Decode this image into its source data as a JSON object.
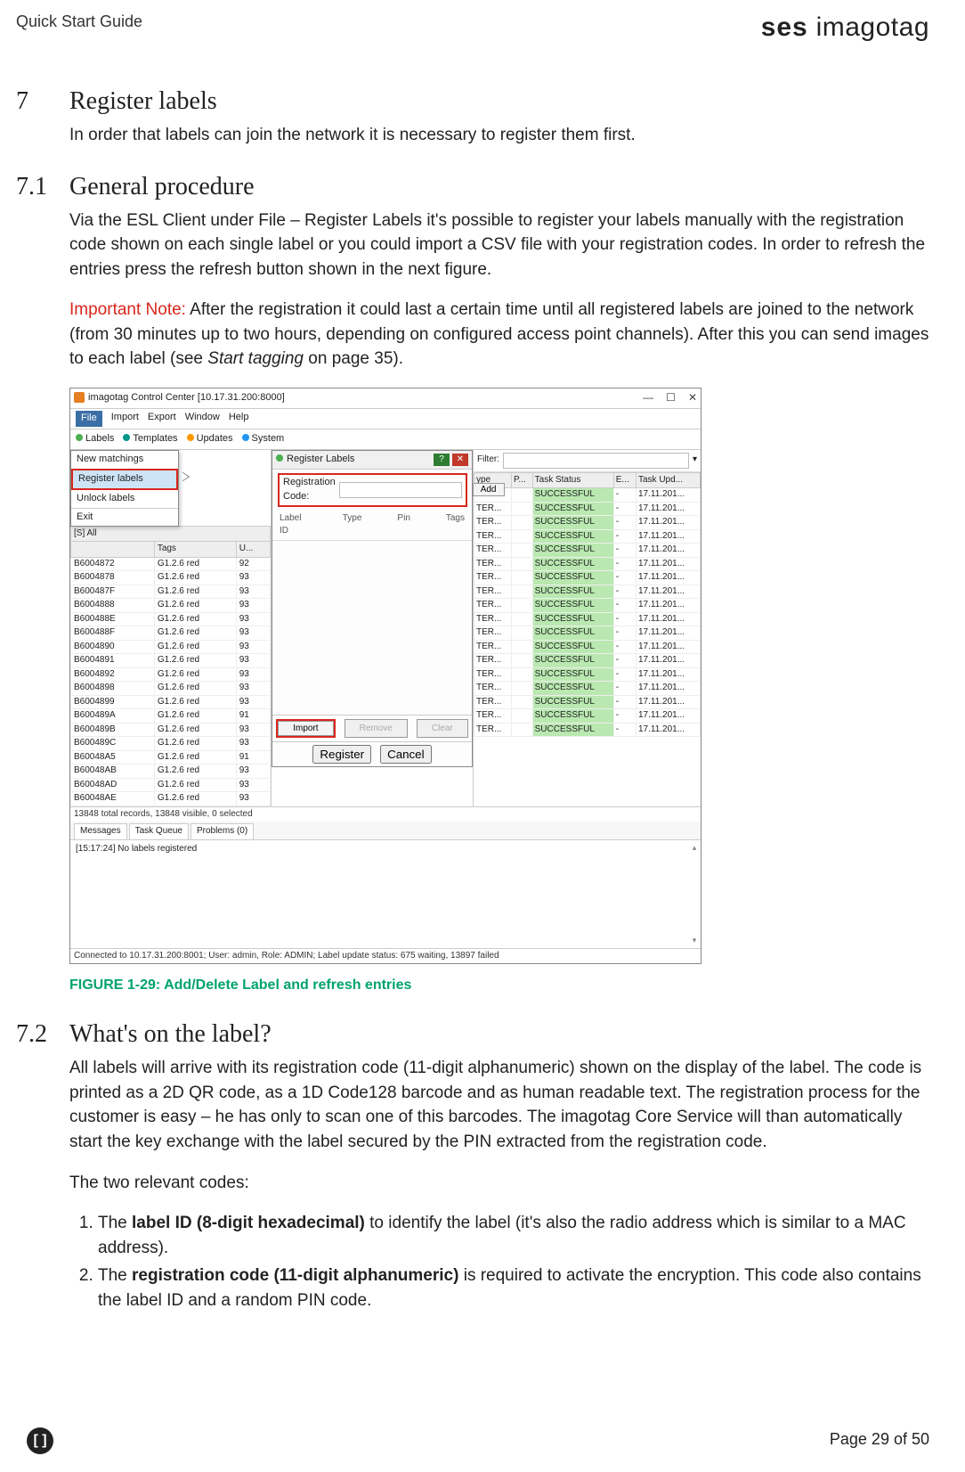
{
  "header": {
    "left": "Quick Start Guide",
    "brand_bold": "ses",
    "brand_light": " imagotag"
  },
  "s7": {
    "num": "7",
    "title": "Register labels",
    "intro": "In order that labels can join the network it is necessary to register them first."
  },
  "s71": {
    "num": "7.1",
    "title": "General procedure",
    "p1": "Via the ESL Client under File – Register Labels it's possible to register your labels manually with the registration code shown on each single label or you could import a CSV file with your registration codes. In order to refresh the entries press the refresh button shown in the next figure.",
    "note_label": "Important Note:",
    "note_rest": " After the registration it could last a certain time until all registered labels are joined to the network (from 30 minutes up to two hours, depending on configured access point channels). After this you can send images to each label (see ",
    "note_italic": "Start tagging",
    "note_tail": " on page 35).",
    "fig_caption": "FIGURE 1-29: Add/Delete Label and refresh entries"
  },
  "s72": {
    "num": "7.2",
    "title": "What's on the label?",
    "p1": "All labels will arrive with its registration code (11-digit alphanumeric) shown on the display of the label. The code is printed as a 2D QR code, as a 1D Code128 barcode and as human readable text. The registration process for the customer is easy – he has only to scan one of this barcodes. The imagotag Core Service will than automatically start the key exchange with the label secured by the PIN extracted from the registration code.",
    "p2": "The two relevant codes:",
    "li1a": "The ",
    "li1b": "label ID (8-digit hexadecimal)",
    "li1c": " to identify the label (it's also the radio address which is similar to a MAC address).",
    "li2a": "The ",
    "li2b": "registration code (11-digit alphanumeric)",
    "li2c": " is required to activate the encryption. This code also contains the label ID and a random PIN code."
  },
  "shot": {
    "title": "imagotag Control Center [10.17.31.200:8000]",
    "wincontrols": {
      "min": "—",
      "max": "☐",
      "close": "✕"
    },
    "menus": [
      "File",
      "Import",
      "Export",
      "Window",
      "Help"
    ],
    "file_menu": [
      "New matchings",
      "Register labels",
      "Unlock labels",
      "Exit"
    ],
    "toolbar": [
      "Labels",
      "Templates",
      "Updates",
      "System"
    ],
    "left_search": "[S]  All",
    "left_headers": [
      "",
      "Tags",
      "U..."
    ],
    "left_rows": [
      [
        "B6004872",
        "G1.2.6 red",
        "92"
      ],
      [
        "B6004878",
        "G1.2.6 red",
        "93"
      ],
      [
        "B600487F",
        "G1.2.6 red",
        "93"
      ],
      [
        "B6004888",
        "G1.2.6 red",
        "93"
      ],
      [
        "B600488E",
        "G1.2.6 red",
        "93"
      ],
      [
        "B600488F",
        "G1.2.6 red",
        "93"
      ],
      [
        "B6004890",
        "G1.2.6 red",
        "93"
      ],
      [
        "B6004891",
        "G1.2.6 red",
        "93"
      ],
      [
        "B6004892",
        "G1.2.6 red",
        "93"
      ],
      [
        "B6004898",
        "G1.2.6 red",
        "93"
      ],
      [
        "B6004899",
        "G1.2.6 red",
        "93"
      ],
      [
        "B600489A",
        "G1.2.6 red",
        "91"
      ],
      [
        "B600489B",
        "G1.2.6 red",
        "93"
      ],
      [
        "B600489C",
        "G1.2.6 red",
        "93"
      ],
      [
        "B60048A5",
        "G1.2.6 red",
        "91"
      ],
      [
        "B60048AB",
        "G1.2.6 red",
        "93"
      ],
      [
        "B60048AD",
        "G1.2.6 red",
        "93"
      ],
      [
        "B60048AE",
        "G1.2.6 red",
        "93"
      ]
    ],
    "left_status": "13848 total records, 13848 visible, 0 selected",
    "dialog": {
      "title": "Register Labels",
      "reg_label": "Registration Code:",
      "add": "Add",
      "cols": [
        "Label ID",
        "Type",
        "Pin",
        "Tags"
      ],
      "import": "Import",
      "remove": "Remove",
      "clear": "Clear",
      "register": "Register",
      "cancel": "Cancel"
    },
    "right": {
      "filter_label": "Filter:",
      "headers": [
        "ype",
        "P...",
        "Task Status",
        "E...",
        "Task Upd..."
      ],
      "rows": [
        [
          "TER...",
          "",
          "SUCCESSFUL",
          "-",
          "17.11.201..."
        ],
        [
          "TER...",
          "",
          "SUCCESSFUL",
          "-",
          "17.11.201..."
        ],
        [
          "TER...",
          "",
          "SUCCESSFUL",
          "-",
          "17.11.201..."
        ],
        [
          "TER...",
          "",
          "SUCCESSFUL",
          "-",
          "17.11.201..."
        ],
        [
          "TER...",
          "",
          "SUCCESSFUL",
          "-",
          "17.11.201..."
        ],
        [
          "TER...",
          "",
          "SUCCESSFUL",
          "-",
          "17.11.201..."
        ],
        [
          "TER...",
          "",
          "SUCCESSFUL",
          "-",
          "17.11.201..."
        ],
        [
          "TER...",
          "",
          "SUCCESSFUL",
          "-",
          "17.11.201..."
        ],
        [
          "TER...",
          "",
          "SUCCESSFUL",
          "-",
          "17.11.201..."
        ],
        [
          "TER...",
          "",
          "SUCCESSFUL",
          "-",
          "17.11.201..."
        ],
        [
          "TER...",
          "",
          "SUCCESSFUL",
          "-",
          "17.11.201..."
        ],
        [
          "TER...",
          "",
          "SUCCESSFUL",
          "-",
          "17.11.201..."
        ],
        [
          "TER...",
          "",
          "SUCCESSFUL",
          "-",
          "17.11.201..."
        ],
        [
          "TER...",
          "",
          "SUCCESSFUL",
          "-",
          "17.11.201..."
        ],
        [
          "TER...",
          "",
          "SUCCESSFUL",
          "-",
          "17.11.201..."
        ],
        [
          "TER...",
          "",
          "SUCCESSFUL",
          "-",
          "17.11.201..."
        ],
        [
          "TER...",
          "",
          "SUCCESSFUL",
          "-",
          "17.11.201..."
        ],
        [
          "TER...",
          "",
          "SUCCESSFUL",
          "-",
          "17.11.201..."
        ]
      ]
    },
    "tabs": [
      "Messages",
      "Task Queue",
      "Problems (0)"
    ],
    "msg": "[15:17:24] No labels registered",
    "conn": "Connected to 10.17.31.200:8001; User: admin, Role: ADMIN; Label update status: 675 waiting, 13897 failed"
  },
  "footer": {
    "page": "Page 29 of 50",
    "icon": "[ ]"
  }
}
